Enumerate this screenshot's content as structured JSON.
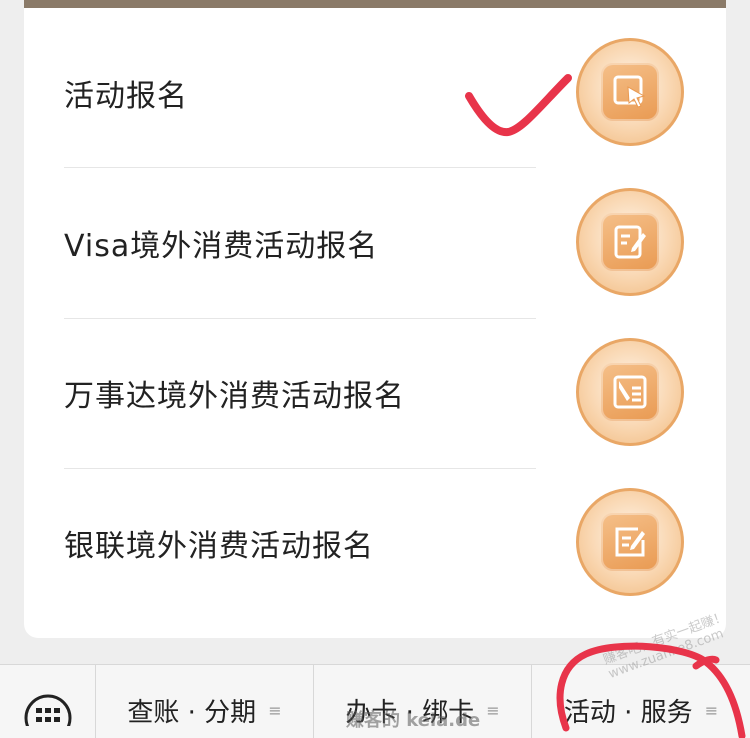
{
  "menu": {
    "items": [
      {
        "label": "活动报名",
        "icon": "cursor-click-icon"
      },
      {
        "label": "Visa境外消费活动报名",
        "icon": "edit-document-icon"
      },
      {
        "label": "万事达境外消费活动报名",
        "icon": "pen-list-icon"
      },
      {
        "label": "银联境外消费活动报名",
        "icon": "edit-square-icon"
      }
    ]
  },
  "annotations": {
    "checkmark_color": "#e8344a",
    "circle_color": "#e8344a"
  },
  "bottom_nav": {
    "keyboard_icon": "keyboard-icon",
    "tabs": [
      {
        "label": "查账 · 分期",
        "glyph": "≡"
      },
      {
        "label": "办卡 · 绑卡",
        "glyph": "≡"
      },
      {
        "label": "活动 · 服务",
        "glyph": "≡"
      }
    ]
  },
  "watermarks": {
    "center": "赚客的 kela.de",
    "right": "赚客吧，有实一起赚！ www.zuanke8.com"
  },
  "colors": {
    "accent_orange": "#e99a52",
    "text": "#222222"
  }
}
